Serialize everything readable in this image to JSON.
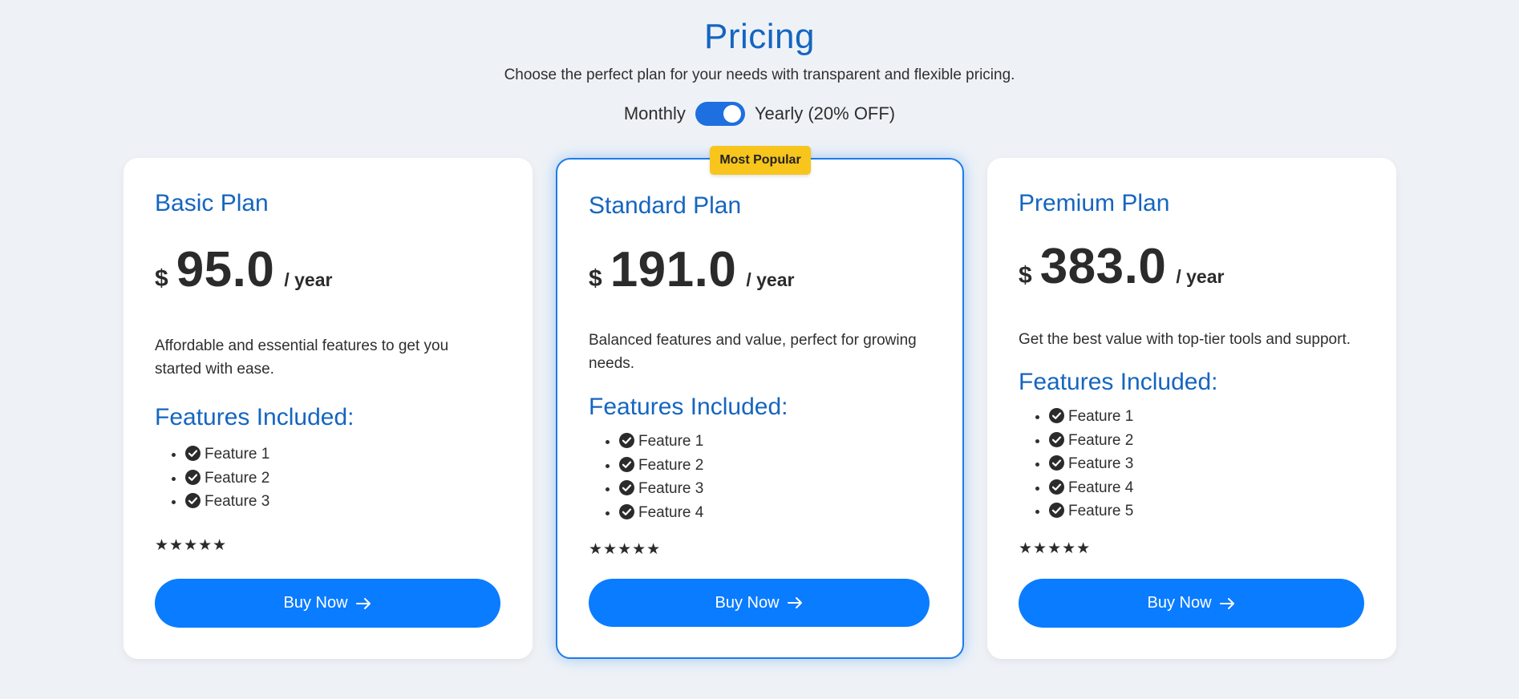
{
  "header": {
    "title": "Pricing",
    "subtitle": "Choose the perfect plan for your needs with transparent and flexible pricing."
  },
  "billing_toggle": {
    "left_label": "Monthly",
    "right_label": "Yearly (20% OFF)",
    "selected": "Yearly (20% OFF)"
  },
  "plans": [
    {
      "name": "Basic Plan",
      "currency": "$",
      "price": "95.0",
      "period": "/ year",
      "description": "Affordable and essential features to get you started with ease.",
      "features_title": "Features Included:",
      "features": [
        "Feature 1",
        "Feature 2",
        "Feature 3"
      ],
      "rating": "★★★★★",
      "button_label": "Buy Now"
    },
    {
      "name": "Standard Plan",
      "badge": "Most Popular",
      "currency": "$",
      "price": "191.0",
      "period": "/ year",
      "description": "Balanced features and value, perfect for growing needs.",
      "features_title": "Features Included:",
      "features": [
        "Feature 1",
        "Feature 2",
        "Feature 3",
        "Feature 4"
      ],
      "rating": "★★★★★",
      "button_label": "Buy Now"
    },
    {
      "name": "Premium Plan",
      "currency": "$",
      "price": "383.0",
      "period": "/ year",
      "description": "Get the best value with top-tier tools and support.",
      "features_title": "Features Included:",
      "features": [
        "Feature 1",
        "Feature 2",
        "Feature 3",
        "Feature 4",
        "Feature 5"
      ],
      "rating": "★★★★★",
      "button_label": "Buy Now"
    }
  ],
  "colors": {
    "accent": "#1565c0",
    "button": "#0a7cff",
    "badge": "#f7c51c",
    "background": "#eef2f7"
  },
  "icons": {
    "check": "check-circle-icon",
    "arrow": "arrow-right-icon",
    "star": "star-icon"
  }
}
